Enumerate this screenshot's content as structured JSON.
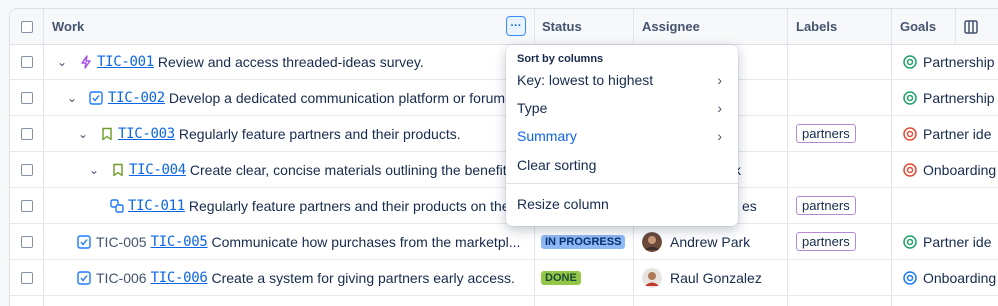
{
  "columns": {
    "work": "Work",
    "status": "Status",
    "assignee": "Assignee",
    "labels": "Labels",
    "goals": "Goals"
  },
  "rows": [
    {
      "chevron": "⌄",
      "key_plain": "",
      "key": "TIC-001",
      "summary": "Review and access threaded-ideas survey.",
      "status": "",
      "assignee": "",
      "label": "",
      "goal": "Partnership"
    },
    {
      "chevron": "⌄",
      "key_plain": "",
      "key": "TIC-002",
      "summary": "Develop a dedicated communication platform or forum...",
      "status": "",
      "assignee": "",
      "label": "",
      "goal": "Partnership"
    },
    {
      "chevron": "⌄",
      "key_plain": "",
      "key": "TIC-003",
      "summary": "Regularly feature partners and their products.",
      "status": "",
      "assignee": "",
      "label": "partners",
      "goal": "Partner ide"
    },
    {
      "chevron": "⌄",
      "key_plain": "",
      "key": "TIC-004",
      "summary": "Create clear, concise materials outlining the benefits...",
      "status": "",
      "assignee": "k",
      "label": "",
      "goal": "Onboarding"
    },
    {
      "chevron": "",
      "key_plain": "",
      "key": "TIC-011",
      "summary": "Regularly feature partners and their products on the...",
      "status": "",
      "assignee": "es",
      "label": "partners",
      "goal": ""
    },
    {
      "chevron": "",
      "key_plain": "TIC-005",
      "key": "TIC-005",
      "summary": "Communicate how purchases from the marketpl...",
      "status": "IN PROGRESS",
      "assignee": "Andrew Park",
      "label": "partners",
      "goal": "Partner ide"
    },
    {
      "chevron": "",
      "key_plain": "TIC-006",
      "key": "TIC-006",
      "summary": "Create a system for giving partners early access.",
      "status": "DONE",
      "assignee": "Raul Gonzalez",
      "label": "",
      "goal": "Onboarding"
    }
  ],
  "menu": {
    "heading": "Sort by columns",
    "items": [
      {
        "label": "Key: lowest to highest",
        "submenu": true,
        "selected": false
      },
      {
        "label": "Type",
        "submenu": true,
        "selected": false
      },
      {
        "label": "Summary",
        "submenu": true,
        "selected": true
      },
      {
        "label": "Clear sorting",
        "submenu": false,
        "selected": false
      },
      {
        "label": "Resize column",
        "submenu": false,
        "selected": false
      }
    ]
  },
  "more_button": "···",
  "colors": {
    "accent": "#0c66e4",
    "goal_green": "#22a06b",
    "goal_red": "#e34935",
    "goal_blue": "#1d7afc",
    "epic": "#a54ee8",
    "task": "#1d7afc",
    "story": "#6a9a23"
  }
}
